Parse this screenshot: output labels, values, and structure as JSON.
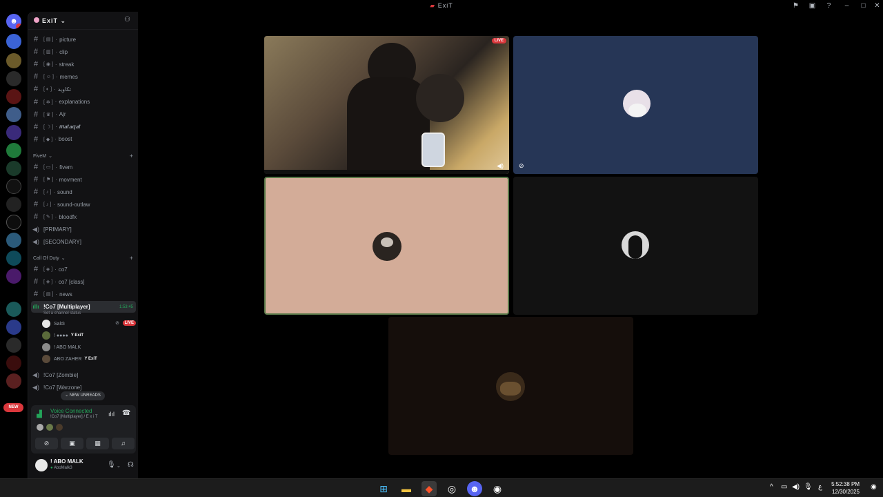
{
  "window": {
    "title": "ExiT"
  },
  "rail": {
    "new_label": "NEW"
  },
  "guild": {
    "name": "ExiT"
  },
  "channels_top": [
    {
      "emoji": "[ ▤ ]",
      "label": "picture"
    },
    {
      "emoji": "[ ▥ ]",
      "label": "clip"
    },
    {
      "emoji": "[ ◉ ]",
      "label": "streak"
    },
    {
      "emoji": "[ ☺ ]",
      "label": "memes"
    },
    {
      "emoji": "[ ◐ ]",
      "label": "تكاويد"
    },
    {
      "emoji": "[ ✲ ]",
      "label": "explanations"
    },
    {
      "emoji": "[ ♛ ]",
      "label": "Ajr"
    },
    {
      "emoji": "[ ☽ ]",
      "label": "𝒎𝒂𝒕𝒂𝒒𝒂𝒕"
    },
    {
      "emoji": "[ ◆ ]",
      "label": "boost"
    }
  ],
  "category_fivem": "FiveM",
  "channels_fivem": [
    {
      "emoji": "[ ▭ ]",
      "label": "fivem"
    },
    {
      "emoji": "[ ⚑ ]",
      "label": "movment"
    },
    {
      "emoji": "[ ♪ ]",
      "label": "sound"
    },
    {
      "emoji": "[ ♪ ]",
      "label": "sound-outlaw"
    },
    {
      "emoji": "[ ✎ ]",
      "label": "bloodfx"
    }
  ],
  "voice_primary": "[PRIMARY]",
  "voice_secondary": "[SECONDARY]",
  "category_cod": "Call Of Duty",
  "channels_cod": [
    {
      "emoji": "[ ◈ ]",
      "label": "co7"
    },
    {
      "emoji": "[ ◈ ]",
      "label": "co7 [class]"
    },
    {
      "emoji": "[ ▤ ]",
      "label": "news"
    }
  ],
  "active_voice": {
    "name": "!Co7 [Multiplayer]",
    "timer": "1:53:45",
    "status": "Set a channel status"
  },
  "voice_users": [
    {
      "name": "Saldı",
      "tag": "",
      "live": "LIVE"
    },
    {
      "name": "! ●●●●",
      "tag": "Y ExiT",
      "live": ""
    },
    {
      "name": "! ABO MALK",
      "tag": "",
      "live": ""
    },
    {
      "name": "ABO ZAHER",
      "tag": "Y ExiT",
      "live": ""
    }
  ],
  "voice_zombie": "!Co7 [Zombie]",
  "voice_warzone": "!Co7 [Warzone]",
  "new_unreads": "NEW UNREADS",
  "voice_panel": {
    "status": "Voice Connected",
    "channel": "!Co7 [Multiplayer] / E x i T"
  },
  "user_panel": {
    "name": "! ABO MALK",
    "status": "AboMalk3"
  },
  "stage": {
    "live_label": "LIVE"
  },
  "clock": {
    "time": "5:52:38 PM",
    "date": "12/30/2025"
  },
  "tray": {
    "lang": "ع"
  },
  "colors": {
    "accent": "#5865f2",
    "live": "#da373c",
    "connected": "#23a55a",
    "tile_blue": "#263656",
    "tile_tan": "#d3ac98",
    "tile_dark": "#121212",
    "tile_brown": "#150e0b"
  },
  "icons": [
    "discord-home-icon",
    "windows-start-icon",
    "file-explorer-icon",
    "brave-icon",
    "steam-icon",
    "discord-icon",
    "obs-icon"
  ]
}
